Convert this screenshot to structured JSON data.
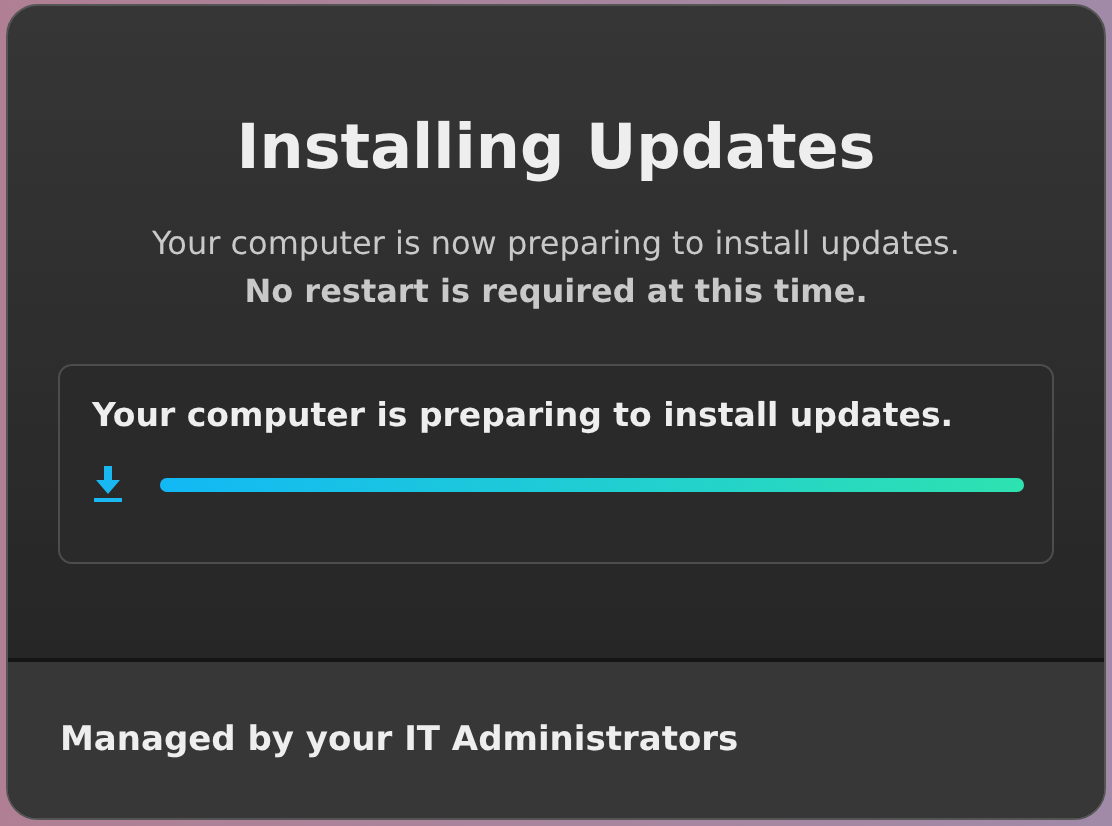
{
  "title": "Installing Updates",
  "message": "Your computer is now preparing to install updates.",
  "message_bold": "No restart is required at this time.",
  "status": {
    "text": "Your computer is preparing to install updates.",
    "level": 1
  },
  "footer": "Managed by your IT Administrators"
}
